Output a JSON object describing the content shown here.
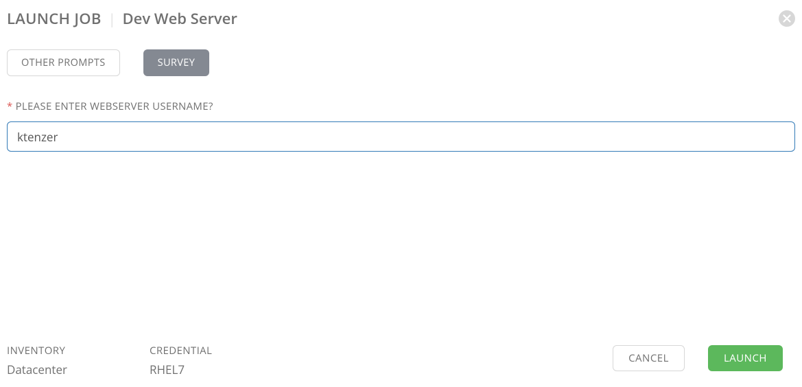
{
  "header": {
    "title_main": "LAUNCH JOB",
    "title_sub": "Dev Web Server"
  },
  "tabs": {
    "other_prompts": "OTHER PROMPTS",
    "survey": "SURVEY"
  },
  "survey": {
    "username_label": "PLEASE ENTER WEBSERVER USERNAME?",
    "username_value": "ktenzer"
  },
  "meta": {
    "inventory_label": "INVENTORY",
    "inventory_value": "Datacenter",
    "credential_label": "CREDENTIAL",
    "credential_value": "RHEL7"
  },
  "actions": {
    "cancel": "CANCEL",
    "launch": "LAUNCH"
  }
}
